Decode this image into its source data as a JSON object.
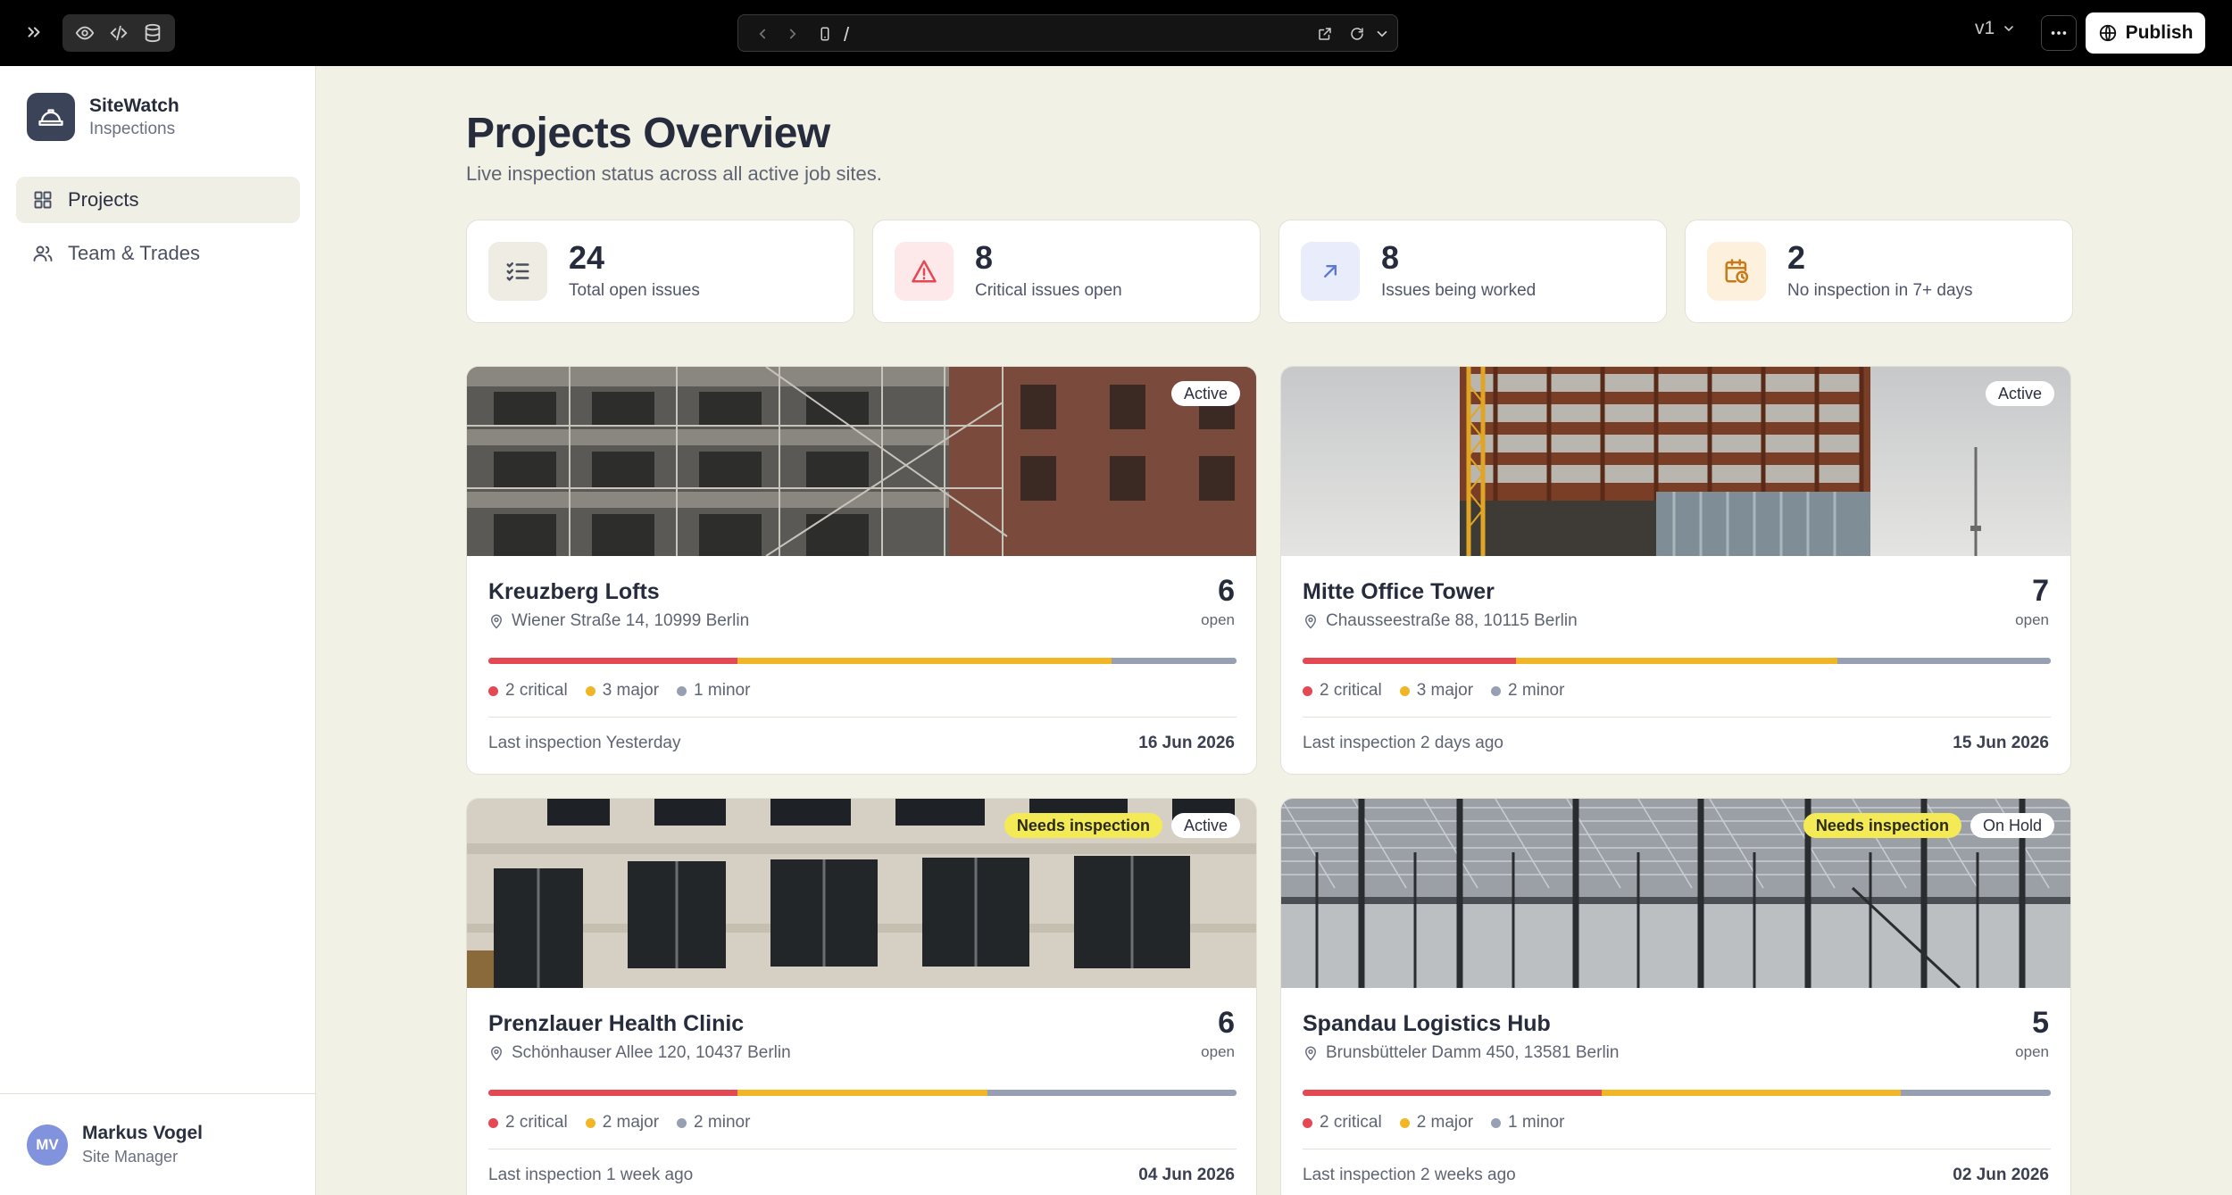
{
  "topbar": {
    "url_path": "/",
    "version": "v1",
    "publish_label": "Publish"
  },
  "sidebar": {
    "brand_name": "SiteWatch",
    "brand_sub": "Inspections",
    "items": [
      {
        "label": "Projects",
        "icon": "grid-icon",
        "active": true
      },
      {
        "label": "Team & Trades",
        "icon": "users-icon",
        "active": false
      }
    ],
    "user": {
      "initials": "MV",
      "name": "Markus Vogel",
      "role": "Site Manager"
    }
  },
  "main": {
    "title": "Projects Overview",
    "subtitle": "Live inspection status across all active job sites.",
    "stats": [
      {
        "value": "24",
        "label": "Total open issues",
        "icon": "checklist-icon",
        "icon_bg": "#eeece3",
        "icon_color": "#4a4f5e"
      },
      {
        "value": "8",
        "label": "Critical issues open",
        "icon": "alert-triangle-icon",
        "icon_bg": "#fde8ea",
        "icon_color": "#e34853"
      },
      {
        "value": "8",
        "label": "Issues being worked",
        "icon": "arrow-up-right-icon",
        "icon_bg": "#e8ecfb",
        "icon_color": "#5a78d8"
      },
      {
        "value": "2",
        "label": "No inspection in 7+ days",
        "icon": "calendar-clock-icon",
        "icon_bg": "#fdf0dc",
        "icon_color": "#c87a18"
      }
    ],
    "projects": [
      {
        "name": "Kreuzberg Lofts",
        "address": "Wiener Straße 14, 10999 Berlin",
        "open_count": "6",
        "open_label": "open",
        "badges": [
          "Active"
        ],
        "severity": {
          "critical": 2,
          "major": 3,
          "minor": 1
        },
        "legend": [
          "2 critical",
          "3 major",
          "1 minor"
        ],
        "last_inspection": "Last inspection Yesterday",
        "date": "16 Jun 2026"
      },
      {
        "name": "Mitte Office Tower",
        "address": "Chausseestraße 88, 10115 Berlin",
        "open_count": "7",
        "open_label": "open",
        "badges": [
          "Active"
        ],
        "severity": {
          "critical": 2,
          "major": 3,
          "minor": 2
        },
        "legend": [
          "2 critical",
          "3 major",
          "2 minor"
        ],
        "last_inspection": "Last inspection 2 days ago",
        "date": "15 Jun 2026"
      },
      {
        "name": "Prenzlauer Health Clinic",
        "address": "Schönhauser Allee 120, 10437 Berlin",
        "open_count": "6",
        "open_label": "open",
        "badges": [
          "Needs inspection",
          "Active"
        ],
        "severity": {
          "critical": 2,
          "major": 2,
          "minor": 2
        },
        "legend": [
          "2 critical",
          "2 major",
          "2 minor"
        ],
        "last_inspection": "Last inspection 1 week ago",
        "date": "04 Jun 2026"
      },
      {
        "name": "Spandau Logistics Hub",
        "address": "Brunsbütteler Damm 450, 13581 Berlin",
        "open_count": "5",
        "open_label": "open",
        "badges": [
          "Needs inspection",
          "On Hold"
        ],
        "severity": {
          "critical": 2,
          "major": 2,
          "minor": 1
        },
        "legend": [
          "2 critical",
          "2 major",
          "1 minor"
        ],
        "last_inspection": "Last inspection 2 weeks ago",
        "date": "02 Jun 2026"
      }
    ]
  },
  "colors": {
    "critical": "#e34853",
    "major": "#f0b626",
    "minor": "#96a0b2",
    "needs_inspection": "#f3ea55"
  }
}
